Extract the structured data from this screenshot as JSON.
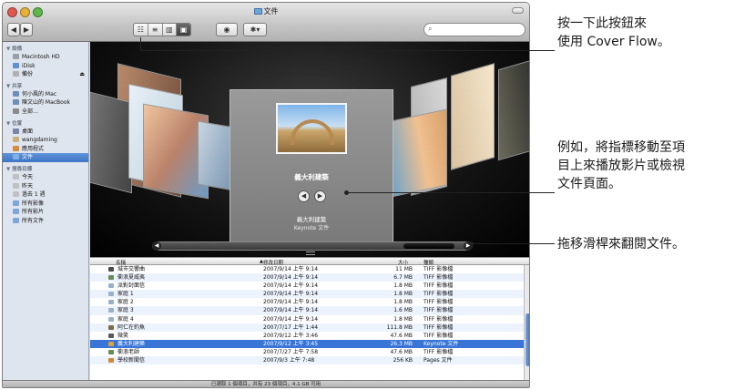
{
  "window": {
    "title": "文件",
    "view_modes": [
      "☷",
      "≡",
      "▥",
      "▣"
    ],
    "quicklook_icon": "eye-icon",
    "action_icon": "gear-icon",
    "action_label": "✱▾",
    "search_placeholder": ""
  },
  "sidebar": {
    "sections": [
      {
        "label": "▼ 設備",
        "items": [
          {
            "label": "Macintosh HD",
            "icon": "hard-disk-icon",
            "color": "#9aa0a8"
          },
          {
            "label": "iDisk",
            "icon": "idisk-icon",
            "color": "#5e8fd0"
          },
          {
            "label": "備份",
            "icon": "backup-icon",
            "color": "#b0b0b0",
            "eject": "⏏"
          }
        ]
      },
      {
        "label": "▼ 共享",
        "items": [
          {
            "label": "何小鳳的 Mac",
            "icon": "computer-icon",
            "color": "#6f8fb8"
          },
          {
            "label": "陳文山的 MacBook",
            "icon": "laptop-icon",
            "color": "#6f8fb8"
          },
          {
            "label": "全部…",
            "icon": "network-icon",
            "color": "#8a8a8a"
          }
        ]
      },
      {
        "label": "▼ 位置",
        "items": [
          {
            "label": "桌面",
            "icon": "desktop-icon",
            "color": "#7b86a6"
          },
          {
            "label": "wangdaming",
            "icon": "home-icon",
            "color": "#c9b27a"
          },
          {
            "label": "應用程式",
            "icon": "applications-icon",
            "color": "#d98b3a"
          },
          {
            "label": "文件",
            "icon": "documents-folder-icon",
            "color": "#7fb0e6",
            "selected": true
          }
        ]
      },
      {
        "label": "▼ 搜尋目標",
        "items": [
          {
            "label": "今天",
            "icon": "clock-icon",
            "color": "#c0c0c0"
          },
          {
            "label": "昨天",
            "icon": "clock-icon",
            "color": "#c0c0c0"
          },
          {
            "label": "過去 1 週",
            "icon": "clock-icon",
            "color": "#c0c0c0"
          },
          {
            "label": "所有影像",
            "icon": "smart-folder-icon",
            "color": "#7ea6d9"
          },
          {
            "label": "所有影片",
            "icon": "smart-folder-icon",
            "color": "#7ea6d9"
          },
          {
            "label": "所有文件",
            "icon": "smart-folder-icon",
            "color": "#7ea6d9"
          }
        ]
      }
    ]
  },
  "coverflow": {
    "center_title": "義大利建築",
    "file_name": "義大利建築",
    "file_kind": "Keynote 文件",
    "prev_icon": "◀",
    "next_icon": "▶",
    "scroll_left": "◀",
    "scroll_right": "▶"
  },
  "list": {
    "columns": [
      "名稱",
      "修改日期",
      "大小",
      "種類"
    ],
    "rows": [
      {
        "name": "城市交響曲",
        "date": "2007/9/14 上午 9:14",
        "size": "11 MB",
        "kind": "TIFF 影像檔",
        "color": "#4a4a4a"
      },
      {
        "name": "衝浪夏威夷",
        "date": "2007/9/14 上午 9:14",
        "size": "6.7 MB",
        "kind": "TIFF 影像檔",
        "color": "#6a8a5a"
      },
      {
        "name": "派對封面信",
        "date": "2007/9/14 上午 9:14",
        "size": "1.8 MB",
        "kind": "TIFF 影像檔",
        "color": "#9ab0c8"
      },
      {
        "name": "家庭 1",
        "date": "2007/9/14 上午 9:14",
        "size": "1.8 MB",
        "kind": "TIFF 影像檔",
        "color": "#9ab0c8"
      },
      {
        "name": "家庭 2",
        "date": "2007/9/14 上午 9:14",
        "size": "1.8 MB",
        "kind": "TIFF 影像檔",
        "color": "#9ab0c8"
      },
      {
        "name": "家庭 3",
        "date": "2007/9/14 上午 9:14",
        "size": "1.6 MB",
        "kind": "TIFF 影像檔",
        "color": "#9ab0c8"
      },
      {
        "name": "家庭 4",
        "date": "2007/9/14 上午 9:14",
        "size": "1.8 MB",
        "kind": "TIFF 影像檔",
        "color": "#9ab0c8"
      },
      {
        "name": "阿仁在釣魚",
        "date": "2007/7/17 上午 1:44",
        "size": "111.8 MB",
        "kind": "TIFF 影像檔",
        "color": "#7a6a4a"
      },
      {
        "name": "微笑",
        "date": "2007/9/12 上午 3:46",
        "size": "47.6 MB",
        "kind": "TIFF 影像檔",
        "color": "#5a5a5a"
      },
      {
        "name": "義大利建築",
        "date": "2007/9/12 上午 3:45",
        "size": "26.3 MB",
        "kind": "Keynote 文件",
        "color": "#d9a441",
        "selected": true
      },
      {
        "name": "衝浪老師",
        "date": "2007/7/27 上午 7:58",
        "size": "47.6 MB",
        "kind": "TIFF 影像檔",
        "color": "#6a8a5a"
      },
      {
        "name": "學校新聞信",
        "date": "2007/9/3 上午 7:48",
        "size": "256 KB",
        "kind": "Pages 文件",
        "color": "#d08a3a"
      }
    ]
  },
  "status": "已選取 1 個項目，共有 23 個項目，4.1 GB 可用",
  "callouts": {
    "top_line1": "按一下此按鈕來",
    "top_line2": "使用 Cover Flow。",
    "mid_line1": "例如，將指標移動至項",
    "mid_line2": "目上來播放影片或檢視",
    "mid_line3": "文件頁面。",
    "bottom": "拖移滑桿來翻閱文件。"
  },
  "colors": {
    "selection": "#3875d7",
    "close": "#e05a4f",
    "minimize": "#e6b23a",
    "zoom": "#5fb84a"
  }
}
